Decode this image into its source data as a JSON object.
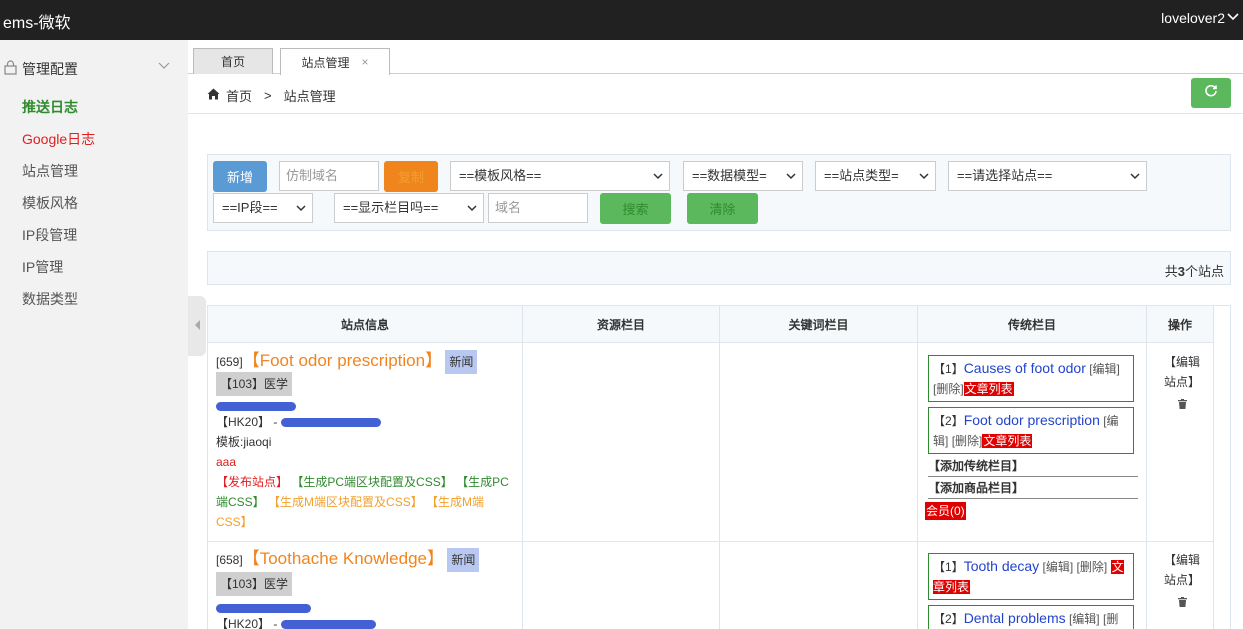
{
  "topbar": {
    "brand": "ems-微软",
    "user": "lovelover2"
  },
  "sidebar": {
    "section": "管理配置",
    "items": [
      "推送日志",
      "Google日志",
      "站点管理",
      "模板风格",
      "IP段管理",
      "IP管理",
      "数据类型"
    ]
  },
  "tabs": [
    {
      "label": "首页"
    },
    {
      "label": "站点管理",
      "close": "×"
    }
  ],
  "breadcrumb": {
    "home": "首页",
    "sep": ">",
    "current": "站点管理"
  },
  "filters": {
    "add_label": "新增",
    "imitate_placeholder": "仿制域名",
    "copy_label": "复制",
    "template_select": "==模板风格==",
    "model_select": "==数据模型=",
    "sitetype_select": "==站点类型=",
    "site_select": "==请选择站点==",
    "ip_select": "==IP段==",
    "show_select": "==显示栏目吗==",
    "domain_placeholder": "域名",
    "search_label": "搜索",
    "clear_label": "清除"
  },
  "count": {
    "prefix": "共",
    "number": "3",
    "suffix": "个站点"
  },
  "table": {
    "headers": [
      "站点信息",
      "资源栏目",
      "关键词栏目",
      "传统栏目",
      "操作"
    ],
    "rows": [
      {
        "id": "[659]",
        "name": "【Foot odor prescription】",
        "tag_news": "新闻",
        "tag_cat": "【103】医学",
        "hk": "【HK20】 - ",
        "template": "模板:jiaoqi",
        "note": "aaa",
        "publish": "【发布站点】",
        "gen_pc": "【生成PC端区块配置及CSS】",
        "gen_pc2": "【生成PC端CSS】",
        "gen_m": "【生成M端区块配置及CSS】",
        "gen_m2": "【生成M端CSS】",
        "columns": [
          {
            "idx": "【1】",
            "name": "Causes of foot odor",
            "edit": "[编辑]",
            "del": "[删除]",
            "list": "文章列表"
          },
          {
            "idx": "【2】",
            "name": "Foot odor prescription",
            "edit": "[编辑]",
            "del": "[删除]",
            "list": "文章列表"
          }
        ],
        "add_traditional": "【添加传统栏目】",
        "add_goods": "【添加商品栏目】",
        "member": "会员(0)",
        "op_edit": "【编辑站点】"
      },
      {
        "id": "[658]",
        "name": "【Toothache Knowledge】",
        "tag_news": "新闻",
        "tag_cat": "【103】医学",
        "hk": "【HK20】 - ",
        "columns": [
          {
            "idx": "【1】",
            "name": "Tooth decay",
            "edit": "[编辑]",
            "del": "[删除]",
            "list": "文章列表"
          },
          {
            "idx": "【2】",
            "name": "Dental problems",
            "edit": "[编辑]",
            "del": "[删"
          }
        ],
        "op_edit": "【编辑站点】"
      }
    ]
  },
  "colors": {
    "topbar": "#212121",
    "green": "#5cb85c",
    "orange": "#f0851e",
    "blue": "#5b9bd5",
    "red": "#e00000"
  }
}
